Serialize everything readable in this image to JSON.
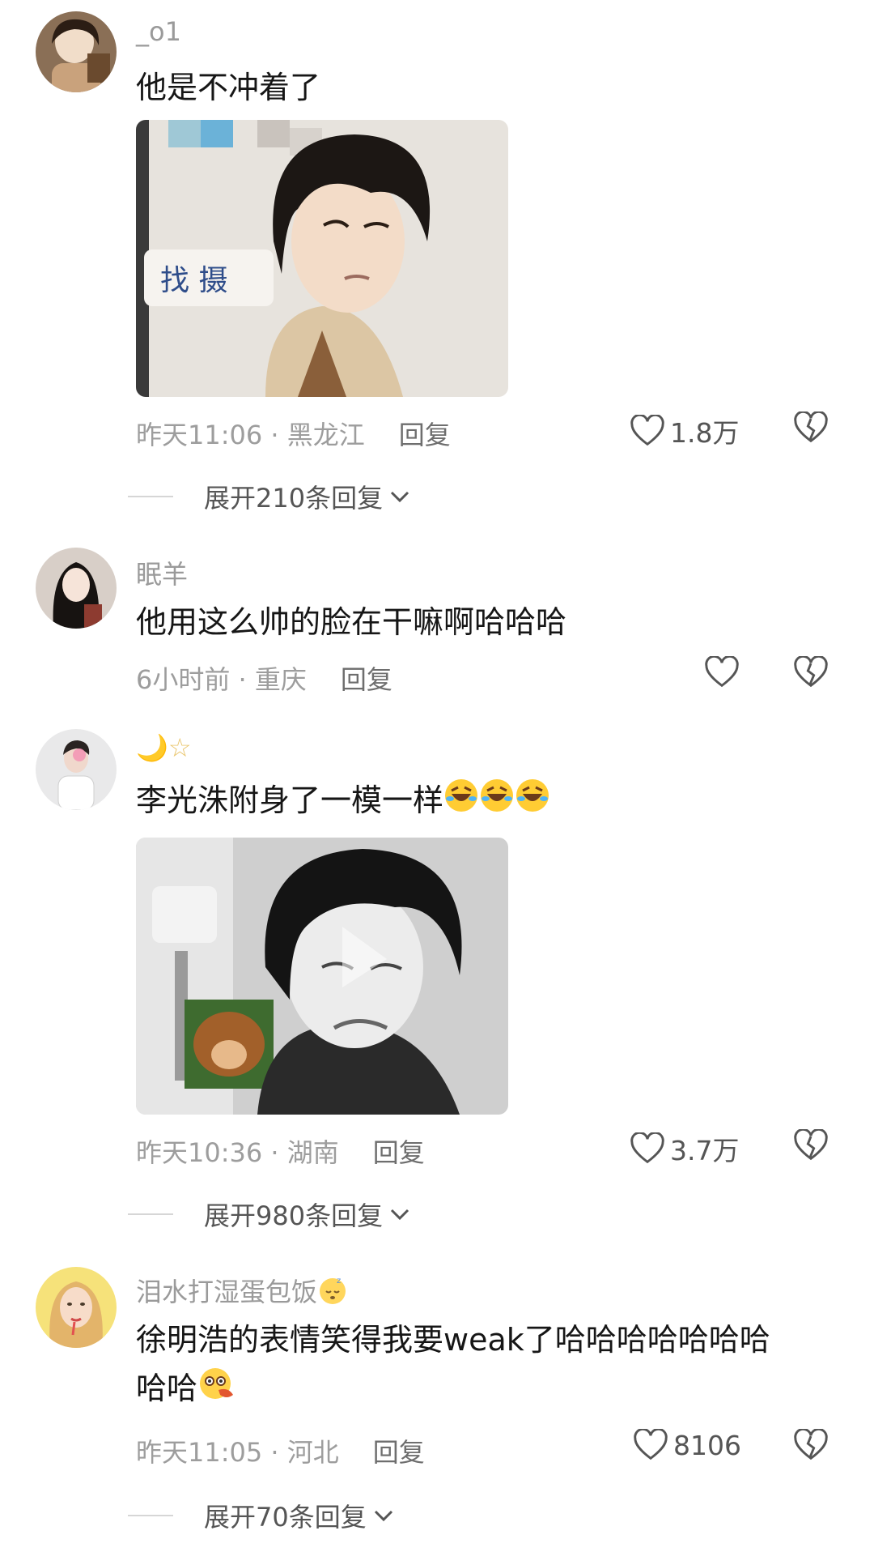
{
  "comments": [
    {
      "username": "_o1",
      "text": "他是不冲着了",
      "time": "昨天11:06",
      "location": "黑龙江",
      "reply_label": "回复",
      "likes": "1.8万",
      "expand_label": "展开210条回复"
    },
    {
      "username": "眠羊",
      "text": "他用这么帅的脸在干嘛啊哈哈哈",
      "time": "6小时前",
      "location": "重庆",
      "reply_label": "回复",
      "likes": ""
    },
    {
      "username": "🌙☆",
      "text": "李光洙附身了一模一样",
      "time": "昨天10:36",
      "location": "湖南",
      "reply_label": "回复",
      "likes": "3.7万",
      "expand_label": "展开980条回复"
    },
    {
      "username": "泪水打湿蛋包饭",
      "text_line1": "徐明浩的表情笑得我要weak了哈哈哈哈哈哈哈",
      "text_line2": "哈哈",
      "time": "昨天11:05",
      "location": "河北",
      "reply_label": "回复",
      "likes": "8106",
      "expand_label": "展开70条回复"
    }
  ],
  "separator": " · ",
  "icons": {
    "like": "heart-outline-icon",
    "dislike": "broken-heart-icon",
    "expand": "chevron-down-icon"
  }
}
